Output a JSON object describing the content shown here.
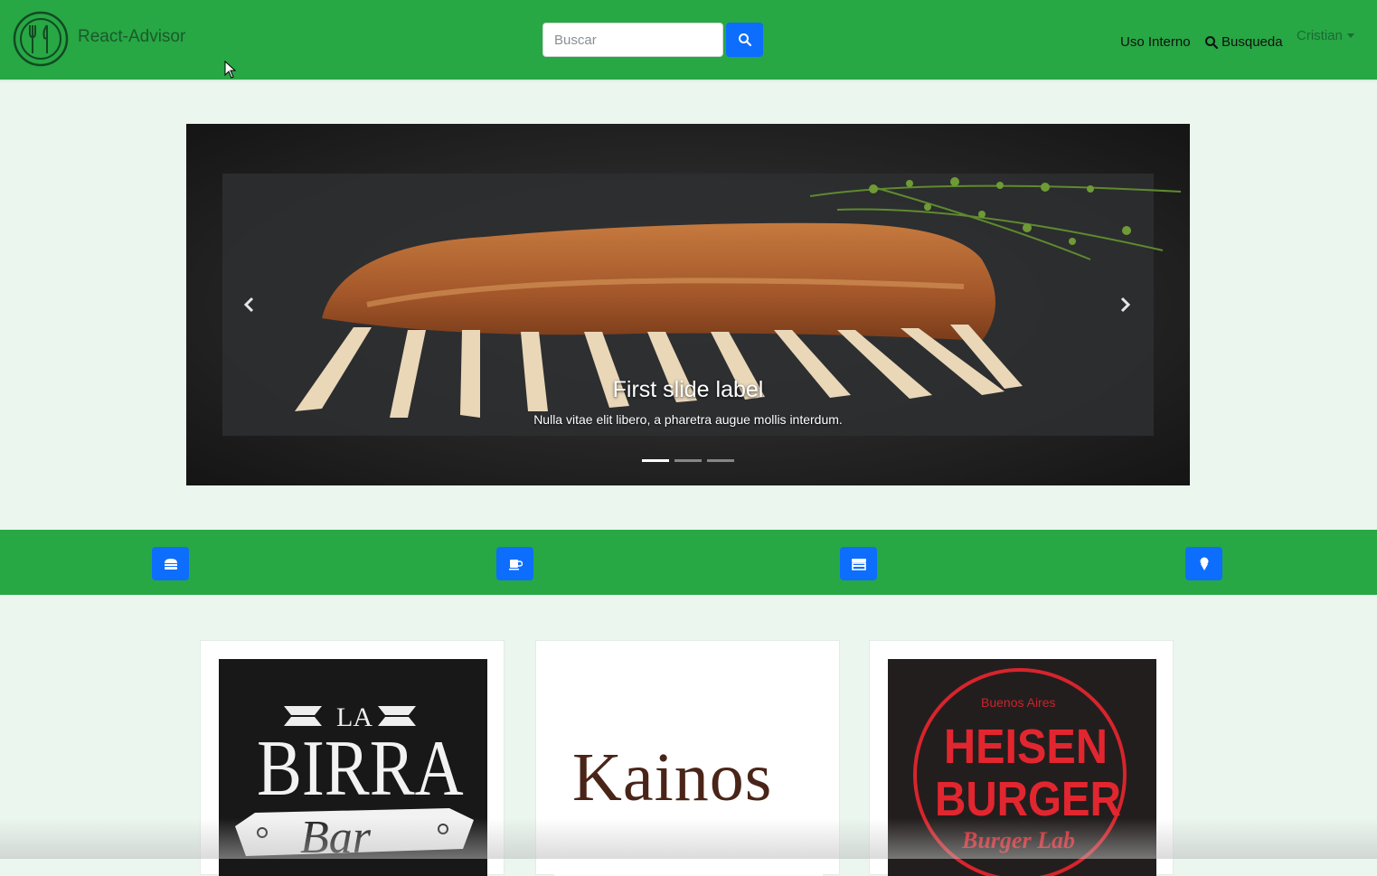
{
  "header": {
    "brand": "React-Advisor",
    "search_placeholder": "Buscar",
    "nav": {
      "uso_interno": "Uso Interno",
      "busqueda": "Busqueda",
      "user": "Cristian"
    }
  },
  "carousel": {
    "title": "First slide label",
    "text": "Nulla vitae elit libero, a pharetra augue mollis interdum.",
    "slide_count": 3,
    "active_index": 0
  },
  "categories": {
    "icons": [
      "burger-icon",
      "coffee-icon",
      "store-icon",
      "ice-cream-icon"
    ]
  },
  "restaurants": [
    {
      "logo_text_top": "LA",
      "logo_text_main": "BIRRA",
      "logo_text_script": "Bar"
    },
    {
      "logo_text_main": "Kainos"
    },
    {
      "logo_text_top": "Buenos Aires",
      "logo_text_main": "HEISEN",
      "logo_text_main2": "BURGER",
      "logo_text_script": "Burger Lab"
    }
  ],
  "colors": {
    "navbar": "#28a745",
    "button": "#0d6efd",
    "page_bg": "#eaf6ee"
  }
}
